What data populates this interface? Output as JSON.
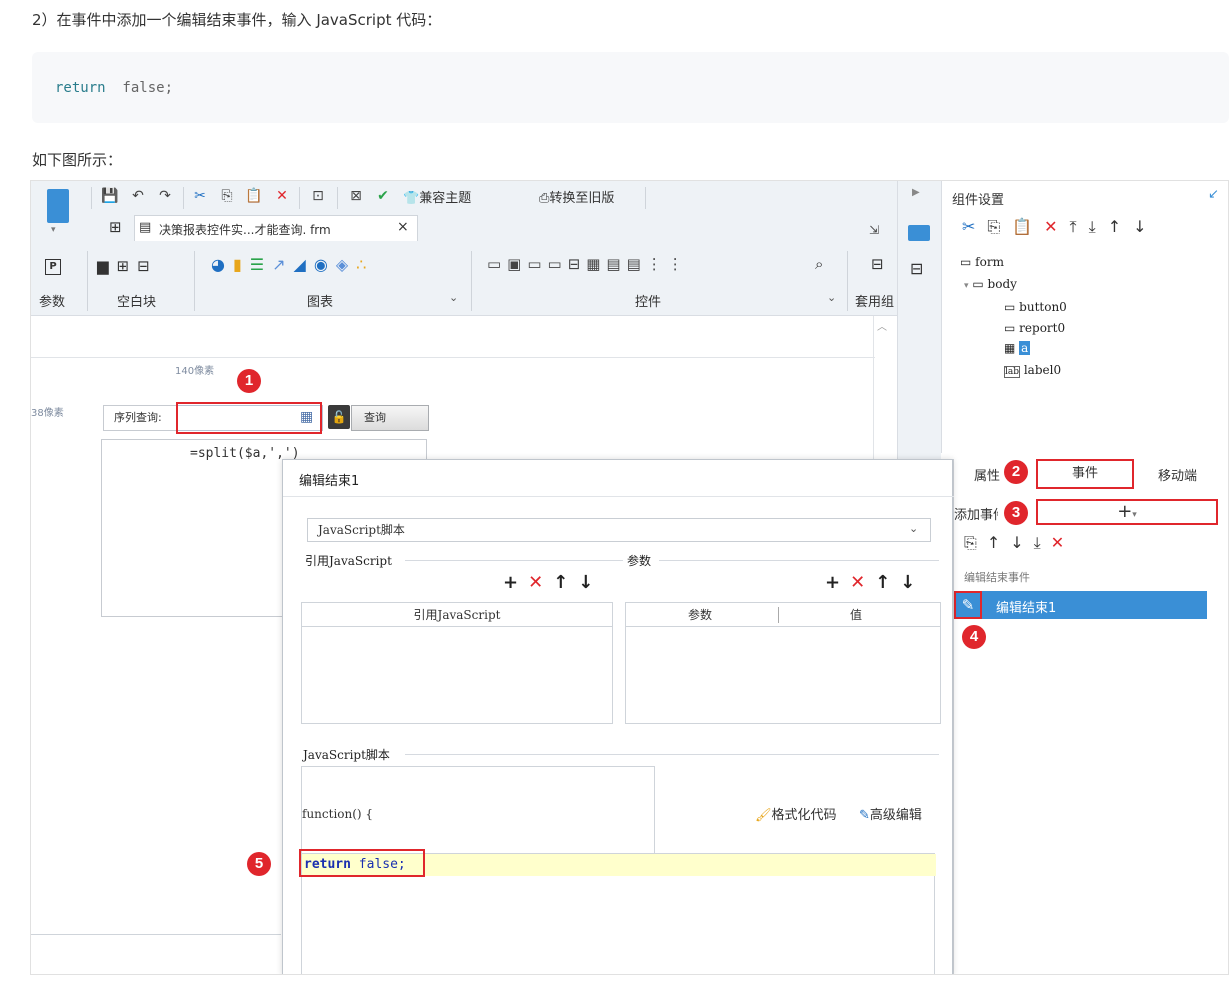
{
  "doc": {
    "step_text": "2）在事件中添加一个编辑结束事件，输入 JavaScript 代码：",
    "code_keyword": "return",
    "code_rest": "  false;",
    "figure_caption": "如下图所示："
  },
  "designer": {
    "toolbar": {
      "compat_theme": "兼容主题",
      "convert_old": "转换至旧版"
    },
    "file_tab": {
      "name": "决策报表控件实...才能查询. frm",
      "close": "×"
    },
    "ribbon": {
      "param_label": "参数",
      "blank_block_label": "空白块",
      "chart_label": "图表",
      "control_label": "控件",
      "layout_label": "套用组"
    },
    "canvas": {
      "ruler_x": "140像素",
      "ruler_y": "38像素",
      "query_label": "序列查询:",
      "query_button": "查询",
      "formula": "=split($a,',')"
    },
    "component_settings": {
      "title": "组件设置",
      "tree": [
        "form",
        "body",
        "button0",
        "report0",
        "a",
        "label0"
      ]
    },
    "prop_tabs": {
      "attributes": "属性",
      "events": "事件",
      "mobile": "移动端"
    },
    "events": {
      "add_event_label": "添加事件",
      "add_symbol": "+",
      "group_label": "编辑结束事件",
      "item_label": "编辑结束1"
    },
    "dialog": {
      "title": "编辑结束1",
      "select_value": "JavaScript脚本",
      "ref_js_label": "引用JavaScript",
      "params_label": "参数",
      "ref_js_col": "引用JavaScript",
      "param_col": "参数",
      "value_col": "值",
      "js_script_label": "JavaScript脚本",
      "function_header": "function() {",
      "format_code": "格式化代码",
      "advanced_edit": "高级编辑",
      "code_return": "return",
      "code_false": " false;"
    },
    "badges": [
      "1",
      "2",
      "3",
      "4",
      "5"
    ]
  }
}
